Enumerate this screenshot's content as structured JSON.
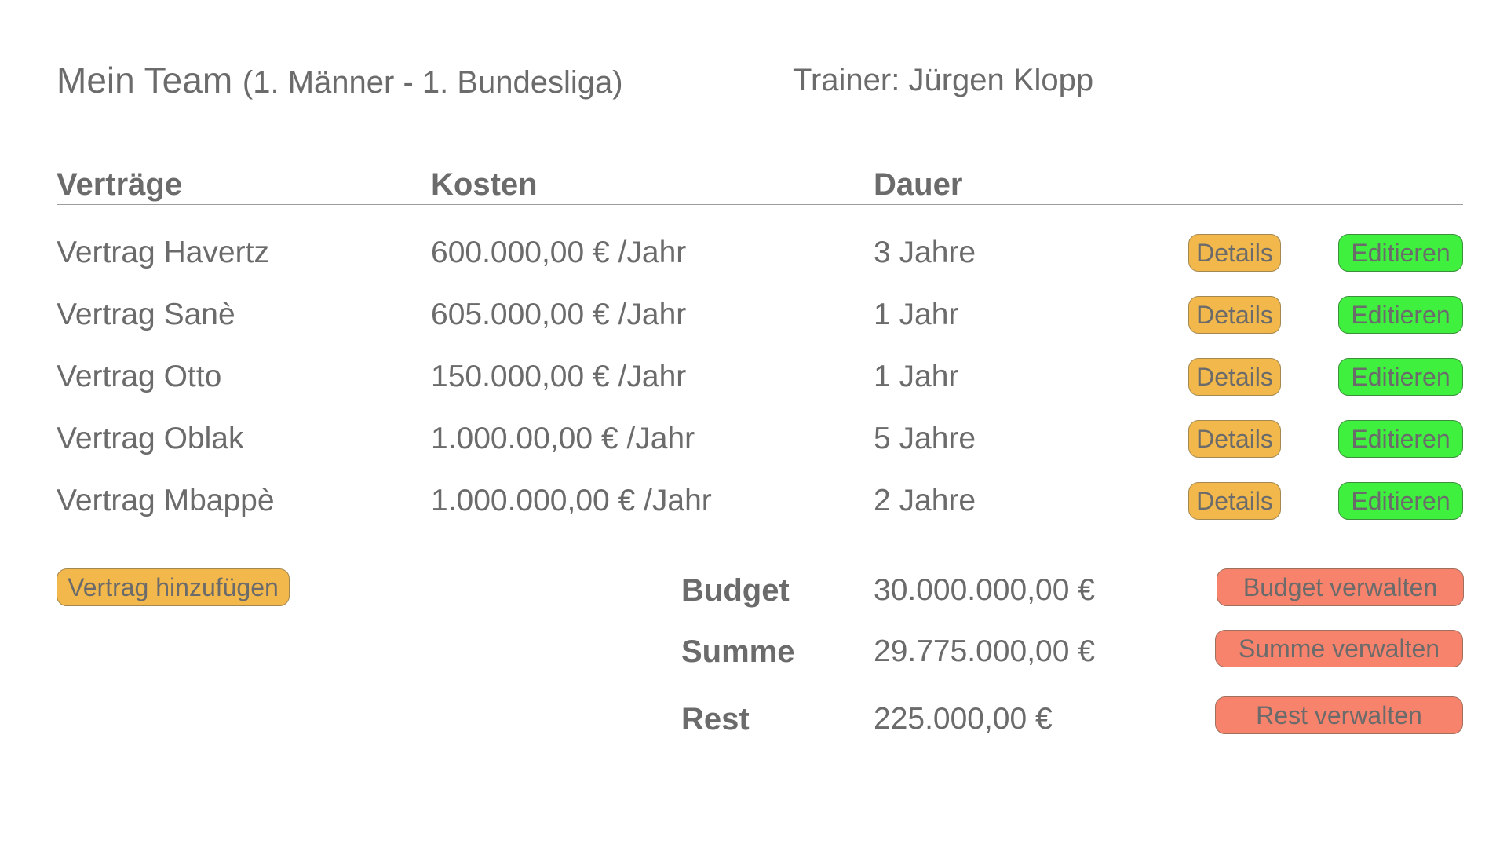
{
  "header": {
    "title": "Mein Team",
    "subtitle": "(1. Männer - 1. Bundesliga)",
    "trainer": "Trainer: Jürgen Klopp"
  },
  "columns": {
    "contracts": "Verträge",
    "costs": "Kosten",
    "duration": "Dauer"
  },
  "contracts": [
    {
      "name": "Vertrag Havertz",
      "cost": "600.000,00 € /Jahr",
      "duration": "3 Jahre",
      "details_label": "Details",
      "edit_label": "Editieren"
    },
    {
      "name": "Vertrag Sanè",
      "cost": "605.000,00 € /Jahr",
      "duration": "1 Jahr",
      "details_label": "Details",
      "edit_label": "Editieren"
    },
    {
      "name": "Vertrag Otto",
      "cost": "150.000,00 € /Jahr",
      "duration": "1 Jahr",
      "details_label": "Details",
      "edit_label": "Editieren"
    },
    {
      "name": "Vertrag Oblak",
      "cost": "1.000.00,00 € /Jahr",
      "duration": "5 Jahre",
      "details_label": "Details",
      "edit_label": "Editieren"
    },
    {
      "name": "Vertrag Mbappè",
      "cost": "1.000.000,00 € /Jahr",
      "duration": "2 Jahre",
      "details_label": "Details",
      "edit_label": "Editieren"
    }
  ],
  "add_contract_label": "Vertrag hinzufügen",
  "summary": {
    "budget": {
      "label": "Budget",
      "value": "30.000.000,00 €",
      "button": "Budget verwalten"
    },
    "sum": {
      "label": "Summe",
      "value": "29.775.000,00 €",
      "button": "Summe verwalten"
    },
    "rest": {
      "label": "Rest",
      "value": "225.000,00 €",
      "button": "Rest verwalten"
    }
  },
  "colors": {
    "details_button": "#f2b84b",
    "edit_button": "#3ff03f",
    "manage_button": "#f8836c",
    "text": "#6b6b6b"
  }
}
